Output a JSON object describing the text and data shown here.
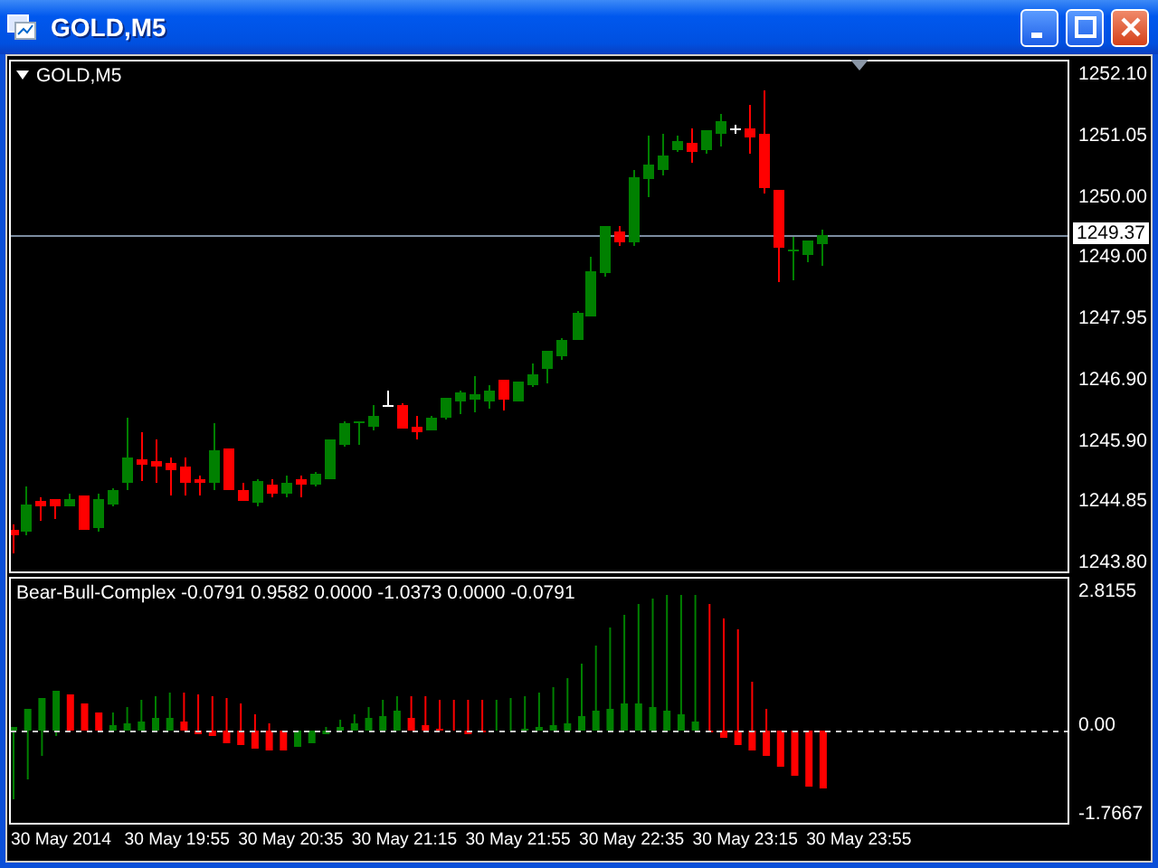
{
  "window": {
    "title": "GOLD,M5",
    "buttons": [
      {
        "kind": "minimize"
      },
      {
        "kind": "maximize"
      },
      {
        "kind": "close"
      }
    ]
  },
  "main_pane": {
    "symbol_label": "GOLD,M5",
    "current_price": "1249.37",
    "price_axis": [
      "1252.10",
      "1251.05",
      "1250.00",
      "1249.00",
      "1247.95",
      "1246.90",
      "1245.90",
      "1244.85",
      "1243.80"
    ]
  },
  "indicator_pane": {
    "label": "Bear-Bull-Complex -0.0791 0.9582 0.0000 -1.0373 0.0000 -0.0791",
    "axis": [
      "2.8155",
      "0.00",
      "-1.7667"
    ]
  },
  "time_axis": [
    "30 May 2014",
    "30 May 19:55",
    "30 May 20:35",
    "30 May 21:15",
    "30 May 21:55",
    "30 May 22:35",
    "30 May 23:15",
    "30 May 23:55"
  ]
}
